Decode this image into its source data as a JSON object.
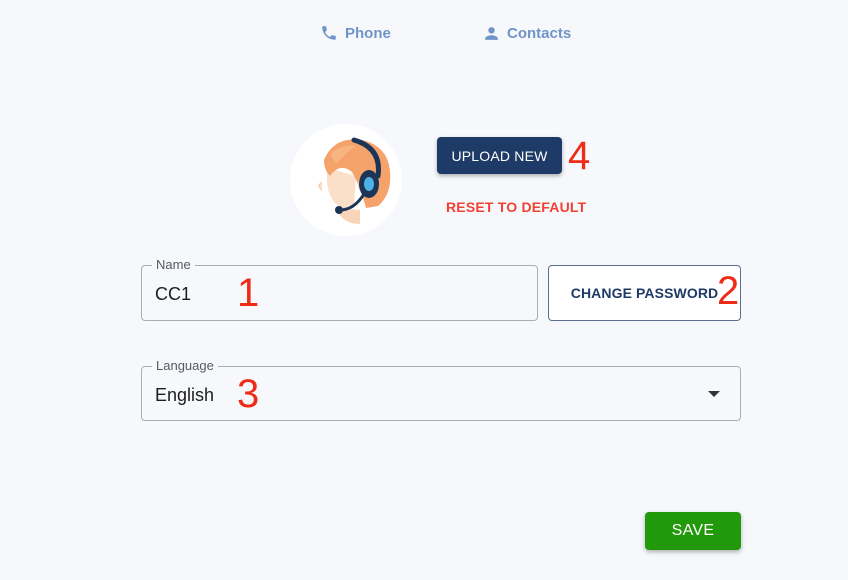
{
  "nav": {
    "phone": {
      "label": "Phone",
      "icon": "phone-icon"
    },
    "contacts": {
      "label": "Contacts",
      "icon": "person-icon"
    }
  },
  "profile": {
    "avatar_icon": "headset-agent-avatar",
    "upload_label": "UPLOAD NEW",
    "reset_label": "RESET TO DEFAULT"
  },
  "form": {
    "name": {
      "label": "Name",
      "value": "CC1"
    },
    "change_password_label": "CHANGE PASSWORD",
    "language": {
      "label": "Language",
      "value": "English"
    },
    "save_label": "SAVE"
  },
  "annotations": {
    "name_marker": "1",
    "password_marker": "2",
    "language_marker": "3",
    "upload_marker": "4"
  },
  "colors": {
    "nav": "#6f95c8",
    "primary": "#1e3a66",
    "danger": "#f14133",
    "save": "#22990a",
    "annotation": "#ef2a17",
    "background": "#f6f8fc"
  }
}
